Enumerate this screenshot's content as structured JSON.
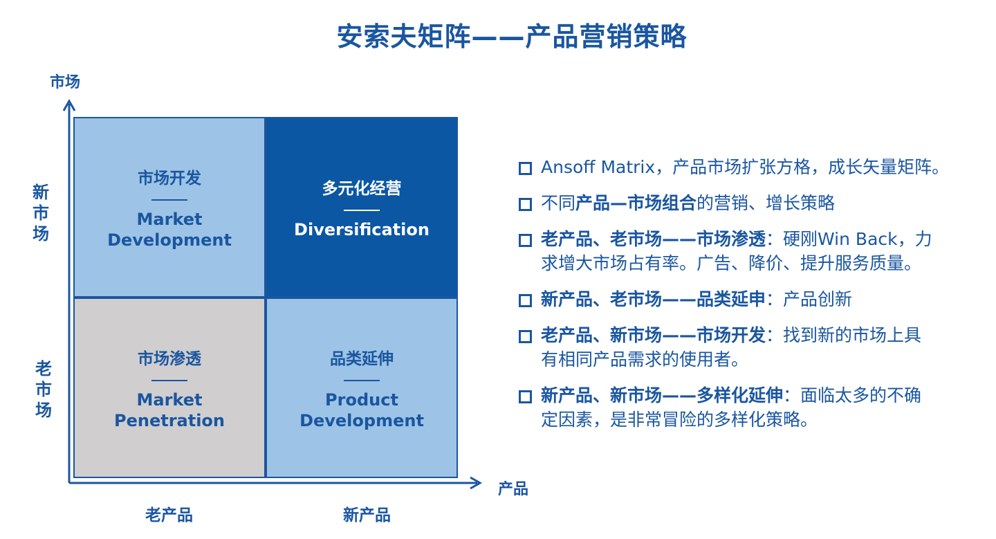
{
  "title": "安索夫矩阵——产品营销策略",
  "axes": {
    "y_title": "市场",
    "x_title": "产品",
    "row_new": [
      "新",
      "市",
      "场"
    ],
    "row_old": [
      "老",
      "市",
      "场"
    ],
    "col_old": "老产品",
    "col_new": "新产品"
  },
  "matrix": {
    "market_development": {
      "zh": "市场开发",
      "en": [
        "Market",
        "Development"
      ]
    },
    "diversification": {
      "zh": "多元化经营",
      "en": [
        "Diversification"
      ]
    },
    "market_penetration": {
      "zh": "市场渗透",
      "en": [
        "Market",
        "Penetration"
      ]
    },
    "product_development": {
      "zh": "品类延伸",
      "en": [
        "Product",
        "Development"
      ]
    }
  },
  "bullets": [
    {
      "bold": "",
      "rest_lines": [
        "Ansoff Matrix，产品市场扩张方格，成长矢量矩阵。"
      ]
    },
    {
      "pre": "不同",
      "bold": "产品—市场组合",
      "rest_lines": [
        "的营销、增长策略"
      ]
    },
    {
      "bold": "老产品、老市场——市场渗透",
      "rest_lines": [
        "：硬刚Win Back，力",
        "求增大市场占有率。广告、降价、提升服务质量。"
      ]
    },
    {
      "bold": "新产品、老市场——品类延申",
      "rest_lines": [
        "：产品创新"
      ]
    },
    {
      "bold": "老产品、新市场——市场开发",
      "rest_lines": [
        "：找到新的市场上具",
        "有相同产品需求的使用者。"
      ]
    },
    {
      "bold": "新产品、新市场——多样化延伸",
      "rest_lines": [
        "：面临太多的不确",
        "定因素，是非常冒险的多样化策略。"
      ]
    }
  ],
  "colors": {
    "primary": "#1a56a0",
    "light_blue": "#9dc3e6",
    "dark_blue": "#0b57a4",
    "gray": "#d0cece"
  }
}
